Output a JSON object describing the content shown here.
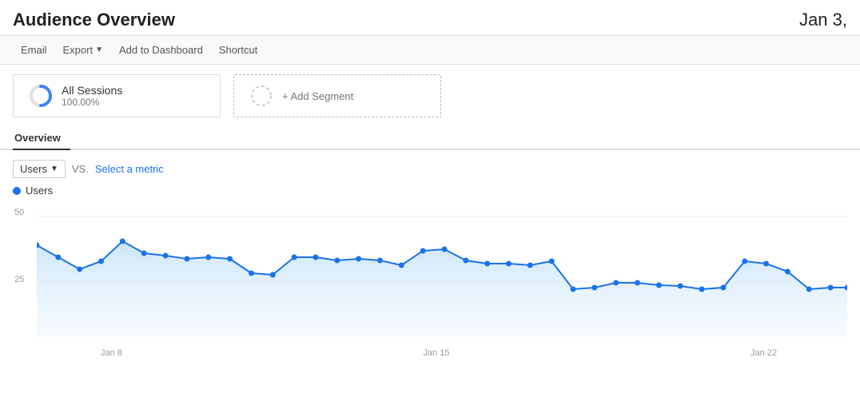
{
  "header": {
    "title": "Audience Overview",
    "date": "Jan 3,"
  },
  "toolbar": {
    "email_label": "Email",
    "export_label": "Export",
    "add_dashboard_label": "Add to Dashboard",
    "shortcut_label": "Shortcut"
  },
  "segments": {
    "active_label": "All Sessions",
    "active_pct": "100.00%",
    "add_label": "+ Add Segment"
  },
  "tabs": {
    "overview_label": "Overview"
  },
  "metric_selector": {
    "metric_label": "Users",
    "vs_label": "VS.",
    "select_label": "Select a metric"
  },
  "chart": {
    "legend_label": "Users",
    "y_labels": [
      "50",
      "25"
    ],
    "x_labels": [
      "Jan 8",
      "Jan 15",
      "Jan 22"
    ],
    "data_points": [
      42,
      37,
      32,
      36,
      44,
      38,
      36,
      35,
      37,
      35,
      29,
      28,
      36,
      36,
      34,
      35,
      33,
      32,
      34,
      30,
      29,
      22,
      23,
      25,
      25,
      25,
      25,
      27,
      25,
      23,
      30,
      28,
      26,
      25,
      25,
      26,
      22,
      22,
      25
    ]
  },
  "colors": {
    "accent_blue": "#1a73e8",
    "chart_fill": "#e8f4fd",
    "chart_line": "#1a73e8",
    "segment_blue": "#4285f4"
  }
}
